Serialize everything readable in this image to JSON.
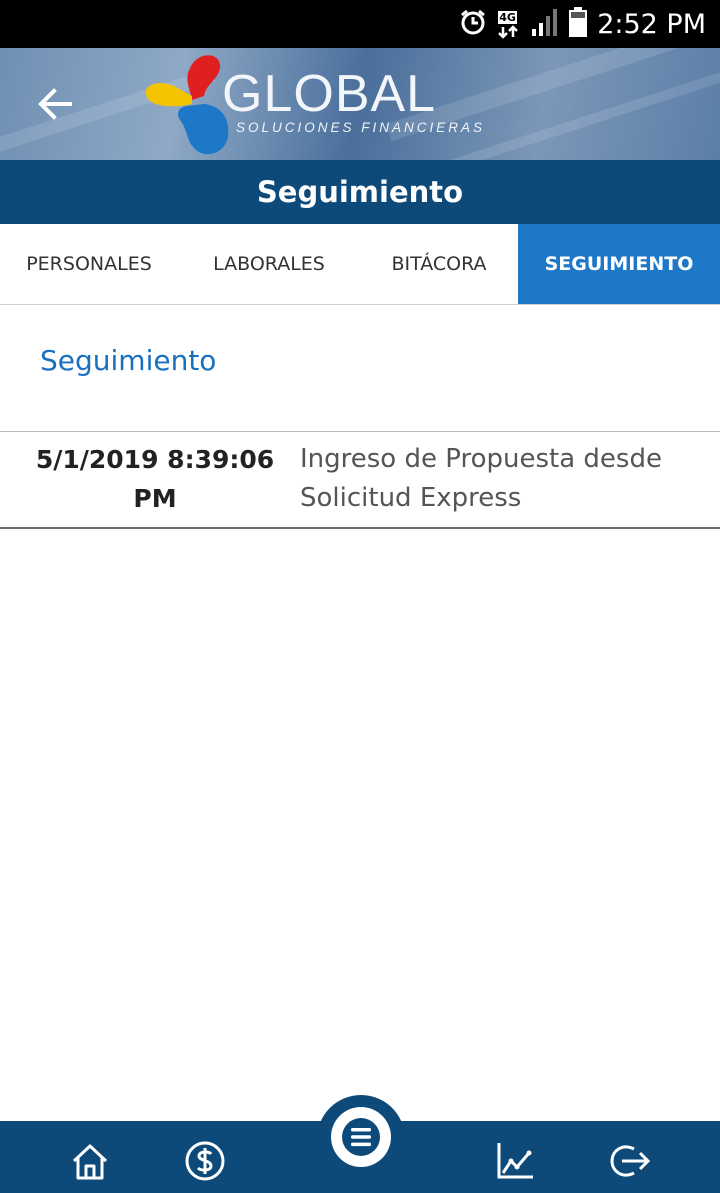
{
  "status_bar": {
    "time": "2:52 PM",
    "network": "4G"
  },
  "header": {
    "logo_word": "GLOBAL",
    "logo_sub": "SOLUCIONES FINANCIERAS"
  },
  "title": "Seguimiento",
  "tabs": [
    {
      "label": "PERSONALES",
      "active": false
    },
    {
      "label": "LABORALES",
      "active": false
    },
    {
      "label": "BITÁCORA",
      "active": false
    },
    {
      "label": "SEGUIMIENTO",
      "active": true
    }
  ],
  "section": {
    "title": "Seguimiento"
  },
  "entries": [
    {
      "date": "5/1/2019 8:39:06 PM",
      "description": "Ingreso de Propuesta desde Solicitud Express"
    }
  ],
  "bottom_nav": {
    "items": [
      "home-icon",
      "dollar-icon",
      "menu-icon",
      "chart-icon",
      "logout-icon"
    ]
  },
  "colors": {
    "primary_dark": "#0d4a7a",
    "accent_blue": "#1e78c8",
    "section_title": "#1a70bf"
  }
}
